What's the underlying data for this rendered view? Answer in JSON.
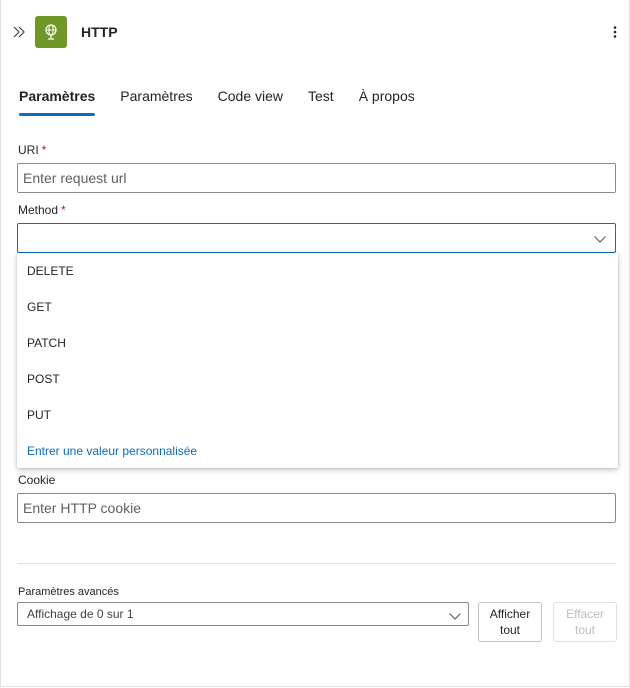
{
  "header": {
    "title": "HTTP",
    "collapse_icon": "double-chevron-right-icon",
    "app_icon": "globe-icon",
    "app_icon_color": "#709727",
    "more_icon": "more-vertical-icon"
  },
  "tabs": [
    {
      "label": "Paramètres",
      "active": true
    },
    {
      "label": "Paramètres",
      "active": false
    },
    {
      "label": "Code view",
      "active": false
    },
    {
      "label": "Test",
      "active": false
    },
    {
      "label": "À propos",
      "active": false
    }
  ],
  "form": {
    "uri": {
      "label": "URI",
      "required_mark": "*",
      "placeholder": "Enter request url",
      "value": ""
    },
    "method": {
      "label": "Method",
      "required_mark": "*",
      "value": ""
    },
    "cookie": {
      "label": "Cookie",
      "placeholder": "Enter HTTP cookie",
      "value": ""
    }
  },
  "method_dropdown": {
    "options": [
      "DELETE",
      "GET",
      "PATCH",
      "POST",
      "PUT"
    ],
    "custom_option": "Entrer une valeur personnalisée"
  },
  "advanced": {
    "label": "Paramètres avancés",
    "selected": "Affichage de 0 sur 1",
    "show_all_label": "Afficher tout",
    "clear_all_label": "Effacer tout"
  },
  "colors": {
    "accent": "#0f6cbd",
    "required": "#c50f1f",
    "disabled_text": "#bdbdbd"
  }
}
